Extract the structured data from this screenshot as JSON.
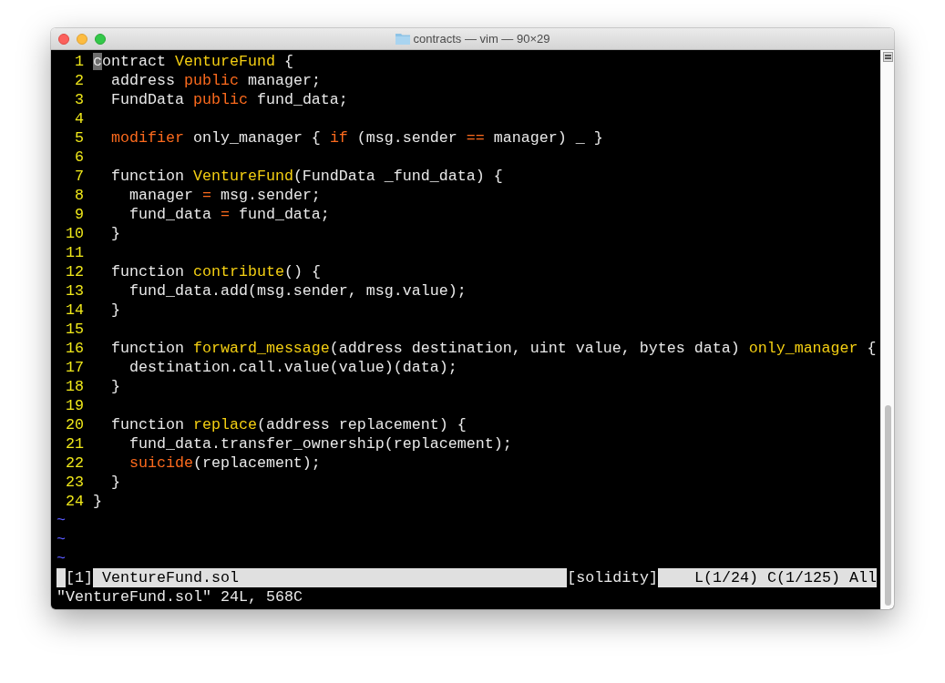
{
  "window": {
    "title": "contracts — vim — 90×29"
  },
  "editor": {
    "lines": [
      {
        "number": "1",
        "tokens": [
          {
            "text": "c",
            "kind": "cursor"
          },
          {
            "text": "ontract ",
            "kind": "plain"
          },
          {
            "text": "VentureFund",
            "kind": "name"
          },
          {
            "text": " {",
            "kind": "plain"
          }
        ]
      },
      {
        "number": "2",
        "tokens": [
          {
            "text": "  address ",
            "kind": "plain"
          },
          {
            "text": "public",
            "kind": "keyword"
          },
          {
            "text": " manager;",
            "kind": "plain"
          }
        ]
      },
      {
        "number": "3",
        "tokens": [
          {
            "text": "  FundData ",
            "kind": "plain"
          },
          {
            "text": "public",
            "kind": "keyword"
          },
          {
            "text": " fund_data;",
            "kind": "plain"
          }
        ]
      },
      {
        "number": "4"
      },
      {
        "number": "5",
        "tokens": [
          {
            "text": "  modifier",
            "kind": "keyword"
          },
          {
            "text": " only_manager { ",
            "kind": "plain"
          },
          {
            "text": "if",
            "kind": "keyword"
          },
          {
            "text": " (msg.sender ",
            "kind": "plain"
          },
          {
            "text": "==",
            "kind": "keyword"
          },
          {
            "text": " manager) _ }",
            "kind": "plain"
          }
        ]
      },
      {
        "number": "6"
      },
      {
        "number": "7",
        "tokens": [
          {
            "text": "  function ",
            "kind": "plain"
          },
          {
            "text": "VentureFund",
            "kind": "name"
          },
          {
            "text": "(FundData _fund_data) {",
            "kind": "plain"
          }
        ]
      },
      {
        "number": "8",
        "tokens": [
          {
            "text": "    manager ",
            "kind": "plain"
          },
          {
            "text": "=",
            "kind": "keyword"
          },
          {
            "text": " msg.sender;",
            "kind": "plain"
          }
        ]
      },
      {
        "number": "9",
        "tokens": [
          {
            "text": "    fund_data ",
            "kind": "plain"
          },
          {
            "text": "=",
            "kind": "keyword"
          },
          {
            "text": " fund_data;",
            "kind": "plain"
          }
        ]
      },
      {
        "number": "10",
        "tokens": [
          {
            "text": "  }",
            "kind": "plain"
          }
        ]
      },
      {
        "number": "11"
      },
      {
        "number": "12",
        "tokens": [
          {
            "text": "  function ",
            "kind": "plain"
          },
          {
            "text": "contribute",
            "kind": "name"
          },
          {
            "text": "() {",
            "kind": "plain"
          }
        ]
      },
      {
        "number": "13",
        "tokens": [
          {
            "text": "    fund_data.add(msg.sender, msg.value);",
            "kind": "plain"
          }
        ]
      },
      {
        "number": "14",
        "tokens": [
          {
            "text": "  }",
            "kind": "plain"
          }
        ]
      },
      {
        "number": "15"
      },
      {
        "number": "16",
        "tokens": [
          {
            "text": "  function ",
            "kind": "plain"
          },
          {
            "text": "forward_message",
            "kind": "name"
          },
          {
            "text": "(address destination, uint value, bytes data) ",
            "kind": "plain"
          },
          {
            "text": "only_manager",
            "kind": "name"
          },
          {
            "text": " {",
            "kind": "plain"
          }
        ]
      },
      {
        "number": "17",
        "tokens": [
          {
            "text": "    destination.call.value(value)(data);",
            "kind": "plain"
          }
        ]
      },
      {
        "number": "18",
        "tokens": [
          {
            "text": "  }",
            "kind": "plain"
          }
        ]
      },
      {
        "number": "19"
      },
      {
        "number": "20",
        "tokens": [
          {
            "text": "  function ",
            "kind": "plain"
          },
          {
            "text": "replace",
            "kind": "name"
          },
          {
            "text": "(address replacement) {",
            "kind": "plain"
          }
        ]
      },
      {
        "number": "21",
        "tokens": [
          {
            "text": "    fund_data.transfer_ownership(replacement);",
            "kind": "plain"
          }
        ]
      },
      {
        "number": "22",
        "tokens": [
          {
            "text": "    suicide",
            "kind": "keyword"
          },
          {
            "text": "(replacement);",
            "kind": "plain"
          }
        ]
      },
      {
        "number": "23",
        "tokens": [
          {
            "text": "  }",
            "kind": "plain"
          }
        ]
      },
      {
        "number": "24",
        "tokens": [
          {
            "text": "}",
            "kind": "plain"
          }
        ]
      }
    ],
    "empty_lines": [
      "~",
      "~",
      "~"
    ],
    "status_line": [
      {
        "text": "[1]",
        "highlight": false
      },
      {
        "text": " VentureFund.sol",
        "highlight": true
      },
      {
        "text": "[solidity]",
        "highlight": false
      },
      {
        "text": "L(1/24) C(1/125) All",
        "highlight": true
      }
    ],
    "message": "\"VentureFund.sol\" 24L, 568C"
  }
}
